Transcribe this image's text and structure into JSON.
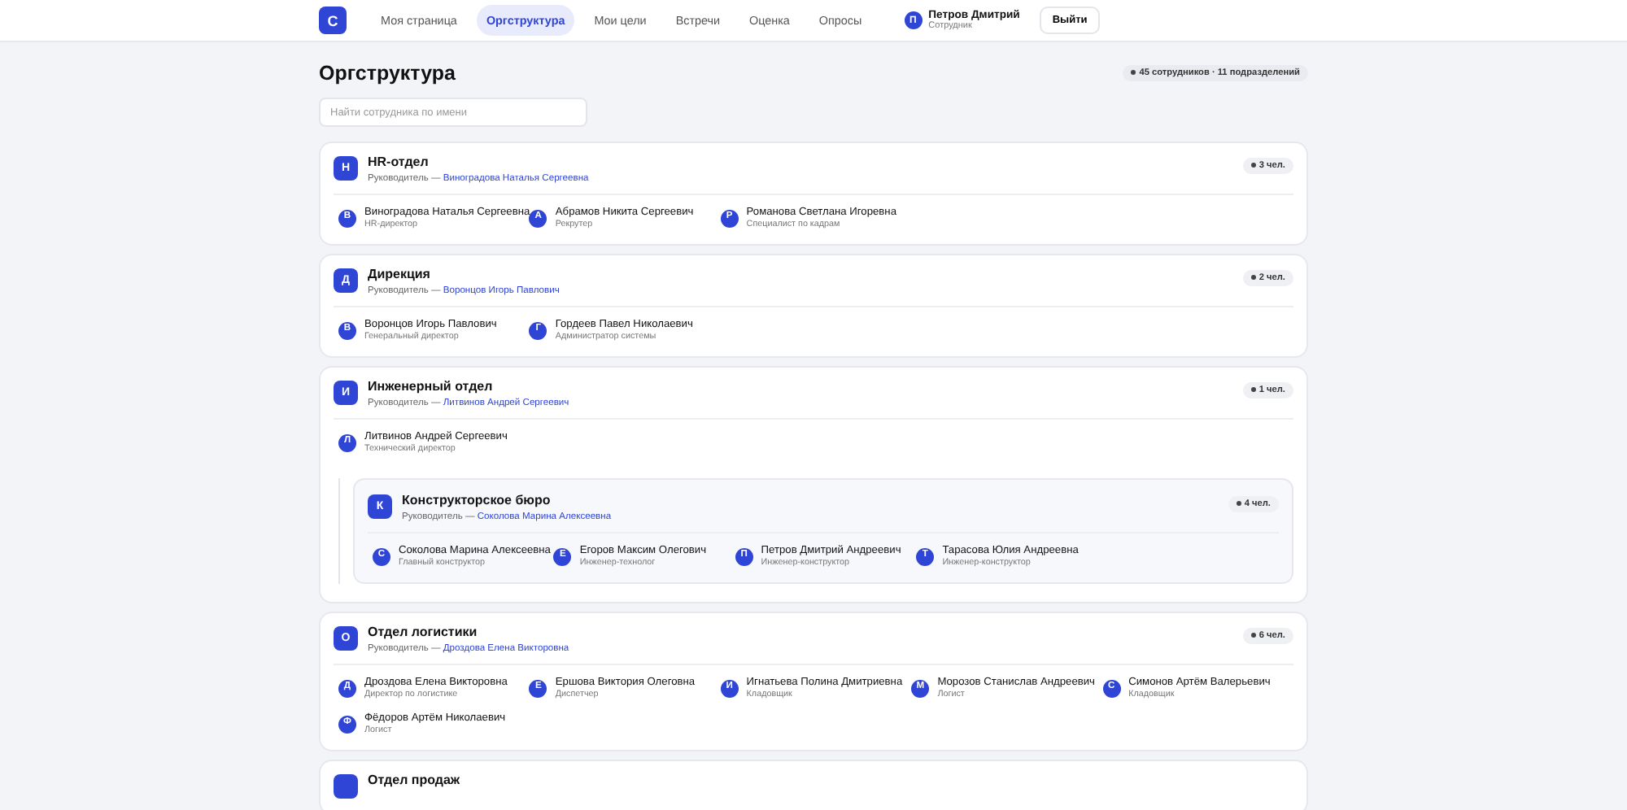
{
  "nav": {
    "logo": "С",
    "items": [
      {
        "label": "Моя страница",
        "selected": false
      },
      {
        "label": "Оргструктура",
        "selected": true
      },
      {
        "label": "Мои цели",
        "selected": false
      },
      {
        "label": "Встречи",
        "selected": false
      },
      {
        "label": "Оценка",
        "selected": false
      },
      {
        "label": "Опросы",
        "selected": false
      }
    ],
    "user": {
      "initial": "П",
      "name": "Петров Дмитрий",
      "role": "Сотрудник"
    },
    "logout": "Выйти"
  },
  "page": {
    "title": "Оргструктура",
    "stats": "45 сотрудников · 11 подразделений",
    "search": {
      "placeholder": "Найти сотрудника по имени"
    }
  },
  "departments": [
    {
      "initial": "H",
      "name": "HR-отдел",
      "leader_label": "Руководитель —",
      "leader": "Виноградова Наталья Сергеевна",
      "count": "3 чел.",
      "members": [
        {
          "initial": "В",
          "name": "Виноградова Наталья Сергеевна",
          "role": "HR-директор"
        },
        {
          "initial": "А",
          "name": "Абрамов Никита Сергеевич",
          "role": "Рекрутер"
        },
        {
          "initial": "Р",
          "name": "Романова Светлана Игоревна",
          "role": "Специалист по кадрам"
        }
      ]
    },
    {
      "initial": "Д",
      "name": "Дирекция",
      "leader_label": "Руководитель —",
      "leader": "Воронцов Игорь Павлович",
      "count": "2 чел.",
      "members": [
        {
          "initial": "В",
          "name": "Воронцов Игорь Павлович",
          "role": "Генеральный директор"
        },
        {
          "initial": "Г",
          "name": "Гордеев Павел Николаевич",
          "role": "Администратор системы"
        }
      ]
    },
    {
      "initial": "И",
      "name": "Инженерный отдел",
      "leader_label": "Руководитель —",
      "leader": "Литвинов Андрей Сергеевич",
      "count": "1 чел.",
      "members": [
        {
          "initial": "Л",
          "name": "Литвинов Андрей Сергеевич",
          "role": "Технический директор"
        }
      ],
      "children": [
        {
          "initial": "К",
          "name": "Конструкторское бюро",
          "leader_label": "Руководитель —",
          "leader": "Соколова Марина Алексеевна",
          "count": "4 чел.",
          "members": [
            {
              "initial": "С",
              "name": "Соколова Марина Алексеевна",
              "role": "Главный конструктор"
            },
            {
              "initial": "Е",
              "name": "Егоров Максим Олегович",
              "role": "Инженер-технолог"
            },
            {
              "initial": "П",
              "name": "Петров Дмитрий Андреевич",
              "role": "Инженер-конструктор"
            },
            {
              "initial": "Т",
              "name": "Тарасова Юлия Андреевна",
              "role": "Инженер-конструктор"
            }
          ]
        }
      ]
    },
    {
      "initial": "О",
      "name": "Отдел логистики",
      "leader_label": "Руководитель —",
      "leader": "Дроздова Елена Викторовна",
      "count": "6 чел.",
      "members": [
        {
          "initial": "Д",
          "name": "Дроздова Елена Викторовна",
          "role": "Директор по логистике"
        },
        {
          "initial": "Е",
          "name": "Ершова Виктория Олеговна",
          "role": "Диспетчер"
        },
        {
          "initial": "И",
          "name": "Игнатьева Полина Дмитриевна",
          "role": "Кладовщик"
        },
        {
          "initial": "М",
          "name": "Морозов Станислав Андреевич",
          "role": "Логист"
        },
        {
          "initial": "С",
          "name": "Симонов Артём Валерьевич",
          "role": "Кладовщик"
        },
        {
          "initial": "Ф",
          "name": "Фёдоров Артём Николаевич",
          "role": "Логист"
        }
      ]
    },
    {
      "name": "Отдел продаж"
    }
  ]
}
